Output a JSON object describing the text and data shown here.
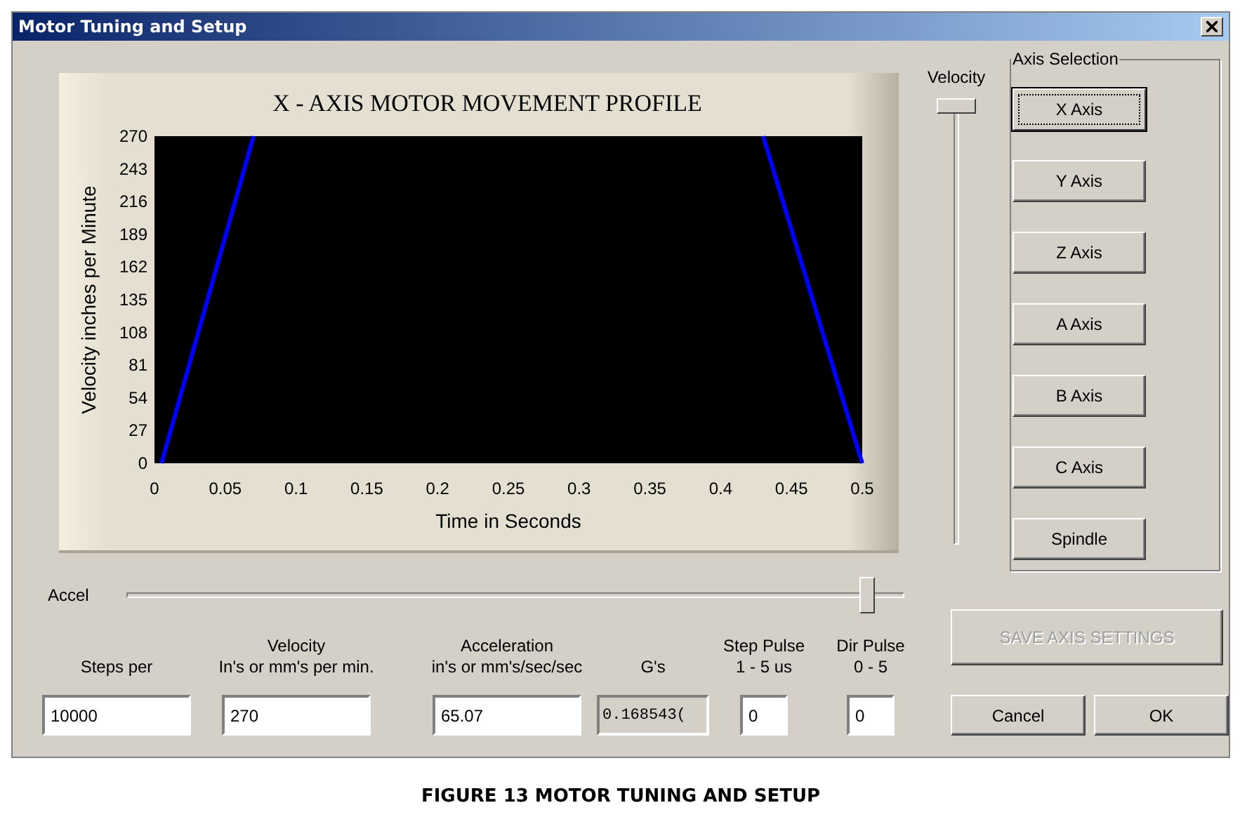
{
  "window": {
    "title": "Motor Tuning and Setup"
  },
  "chart_panel": {
    "chart_data": {
      "type": "line",
      "title": "X - AXIS MOTOR MOVEMENT PROFILE",
      "xlabel": "Time in Seconds",
      "ylabel": "Velocity inches per Minute",
      "x": [
        0.005,
        0.07,
        0.43,
        0.5
      ],
      "series": [
        {
          "color": "#0000ff",
          "values": [
            0,
            270,
            null,
            null
          ]
        },
        {
          "color": "#0000ff",
          "values": [
            null,
            null,
            270,
            0
          ]
        }
      ],
      "xlim": [
        0,
        0.5
      ],
      "ylim": [
        0,
        270
      ],
      "xticks": [
        0,
        0.05,
        0.1,
        0.15,
        0.2,
        0.25,
        0.3,
        0.35,
        0.4,
        0.45,
        0.5
      ],
      "yticks": [
        0,
        27,
        54,
        81,
        108,
        135,
        162,
        189,
        216,
        243,
        270
      ]
    }
  },
  "velocity_slider": {
    "label": "Velocity",
    "level": 1
  },
  "axis_selection": {
    "title": "Axis Selection",
    "buttons": [
      {
        "label": "X Axis",
        "selected": true
      },
      {
        "label": "Y Axis",
        "selected": false
      },
      {
        "label": "Z Axis",
        "selected": false
      },
      {
        "label": "A Axis",
        "selected": false
      },
      {
        "label": "B Axis",
        "selected": false
      },
      {
        "label": "C Axis",
        "selected": false
      },
      {
        "label": "Spindle",
        "selected": false
      }
    ]
  },
  "accel_slider": {
    "label": "Accel",
    "level": 0.96
  },
  "fields": [
    {
      "label": [
        "Steps per"
      ],
      "value": "10000",
      "readonly": false
    },
    {
      "label": [
        "Velocity",
        "In's or mm's per min."
      ],
      "value": "270",
      "readonly": false
    },
    {
      "label": [
        "Acceleration",
        "in's or mm's/sec/sec"
      ],
      "value": "65.07",
      "readonly": false
    },
    {
      "label": [
        "G's"
      ],
      "value": "0.168543(",
      "readonly": true
    },
    {
      "label": [
        "Step Pulse",
        "1 - 5 us"
      ],
      "value": "0",
      "readonly": false
    },
    {
      "label": [
        "Dir Pulse",
        "0 - 5"
      ],
      "value": "0",
      "readonly": false
    }
  ],
  "buttons": [
    {
      "label": "SAVE AXIS SETTINGS",
      "disabled": true
    },
    {
      "label": "Cancel",
      "disabled": false
    },
    {
      "label": "OK",
      "disabled": false
    }
  ],
  "caption": "FIGURE 13 MOTOR TUNING AND SETUP"
}
